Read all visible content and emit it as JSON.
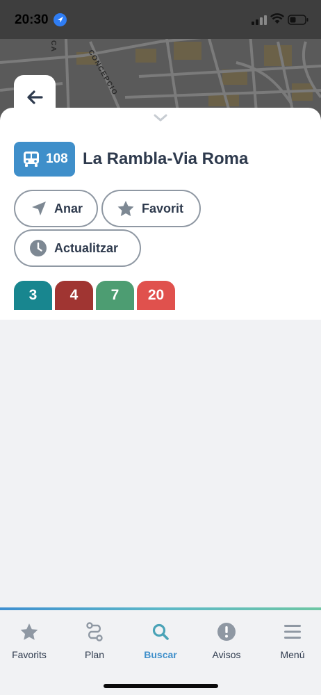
{
  "status_bar": {
    "time": "20:30"
  },
  "map": {
    "street_labels": [
      "CA",
      "CONCEPCIO"
    ]
  },
  "route": {
    "number": "108",
    "name": "La Rambla-Via Roma",
    "badge_color": "#3f8fca"
  },
  "actions": {
    "go_label": "Anar",
    "favorite_label": "Favorit",
    "refresh_label": "Actualitzar"
  },
  "lines": [
    {
      "label": "3",
      "color": "#18868f"
    },
    {
      "label": "4",
      "color": "#a03532"
    },
    {
      "label": "7",
      "color": "#4d9d72"
    },
    {
      "label": "20",
      "color": "#e0514d"
    }
  ],
  "tabs": [
    {
      "label": "Favorits",
      "icon": "star-icon",
      "active": false
    },
    {
      "label": "Plan",
      "icon": "route-icon",
      "active": false
    },
    {
      "label": "Buscar",
      "icon": "search-icon",
      "active": true
    },
    {
      "label": "Avisos",
      "icon": "alert-icon",
      "active": false
    },
    {
      "label": "Menú",
      "icon": "menu-icon",
      "active": false
    }
  ],
  "colors": {
    "accent": "#3f8fca",
    "text": "#2e3a4d",
    "pill_border": "#8f98a3"
  }
}
